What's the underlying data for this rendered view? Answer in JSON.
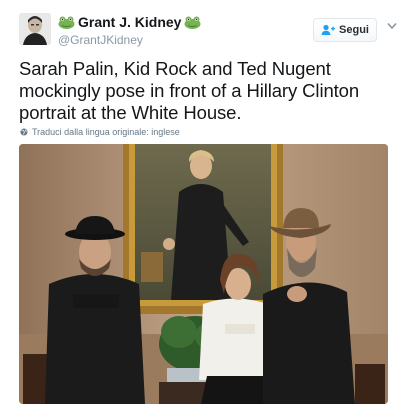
{
  "author": {
    "display_name": "Grant J. Kidney",
    "handle": "@GrantJKidney",
    "avatar": "avatar-photo",
    "emoji_left": "frog-face-emoji",
    "emoji_right": "frog-face-emoji"
  },
  "follow": {
    "label": "Segui",
    "icon": "add-person-icon"
  },
  "menu": {
    "icon": "chevron-down-icon"
  },
  "tweet": {
    "text": "Sarah Palin, Kid Rock and Ted Nugent mockingly pose in front of a Hillary Clinton portrait at the White House."
  },
  "translation": {
    "label": "Traduci dalla lingua originale: inglese",
    "icon": "globe-icon"
  },
  "media": {
    "type": "photo",
    "colors": {
      "wall": "#b89a7c",
      "frame": "#a3782c",
      "canvas": "#5c5a43"
    }
  },
  "colors": {
    "text": "#14171a",
    "muted": "#657786",
    "button_border": "#e1e8ed",
    "accent": "#1da1f2"
  }
}
